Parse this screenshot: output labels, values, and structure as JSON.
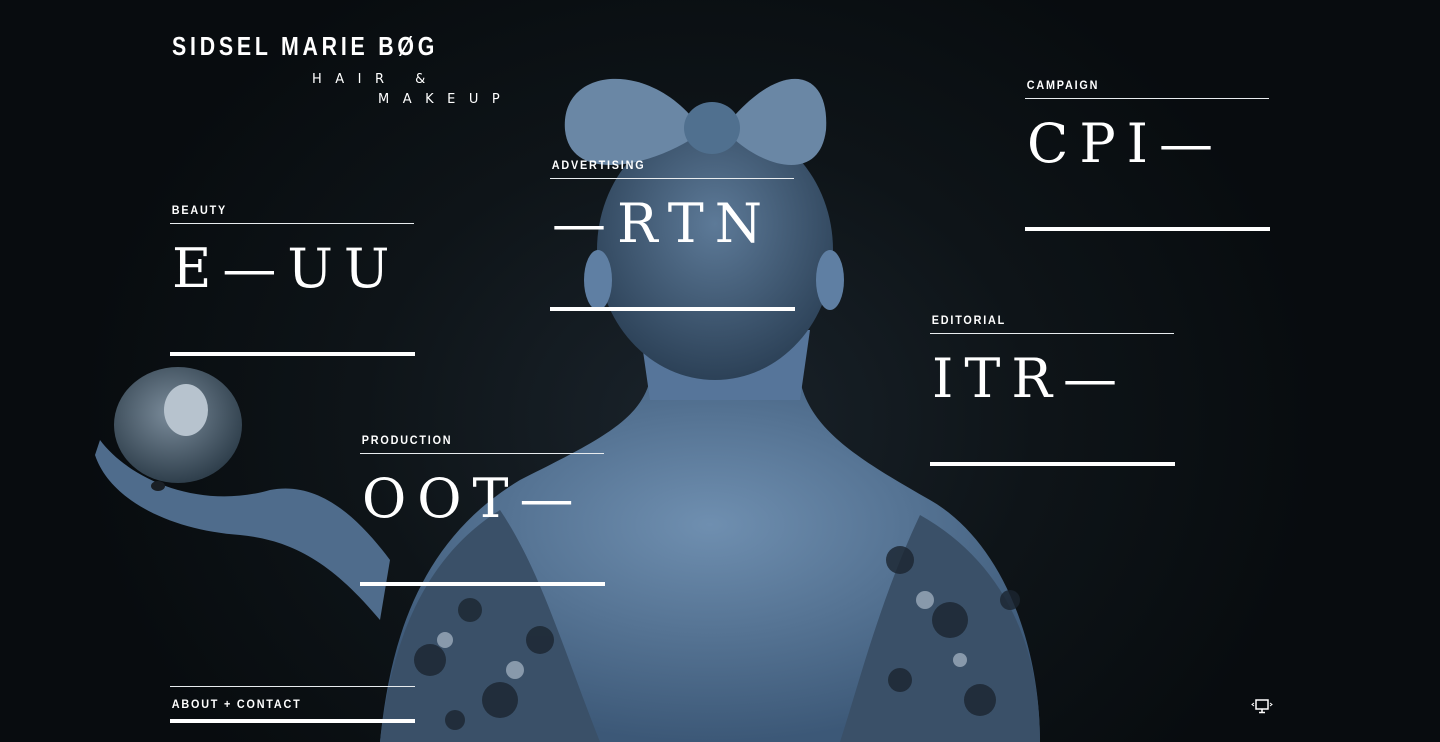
{
  "brand": {
    "name": "SIDSEL MARIE BØG",
    "tagline_line1": "HAIR &",
    "tagline_line2": "MAKEUP"
  },
  "tiles": [
    {
      "label": "BEAUTY",
      "word": "E—UU"
    },
    {
      "label": "ADVERTISING",
      "word": "—RTN"
    },
    {
      "label": "CAMPAIGN",
      "word": "CPI—"
    },
    {
      "label": "EDITORIAL",
      "word": "ITR—"
    },
    {
      "label": "PRODUCTION",
      "word": "OOT—"
    }
  ],
  "footer": {
    "about_label": "ABOUT + CONTACT",
    "fullscreen_icon": "monitor-icon"
  },
  "colors": {
    "background": "#0b1014",
    "photo_tint": "#4a6a8c",
    "text": "#ffffff"
  }
}
